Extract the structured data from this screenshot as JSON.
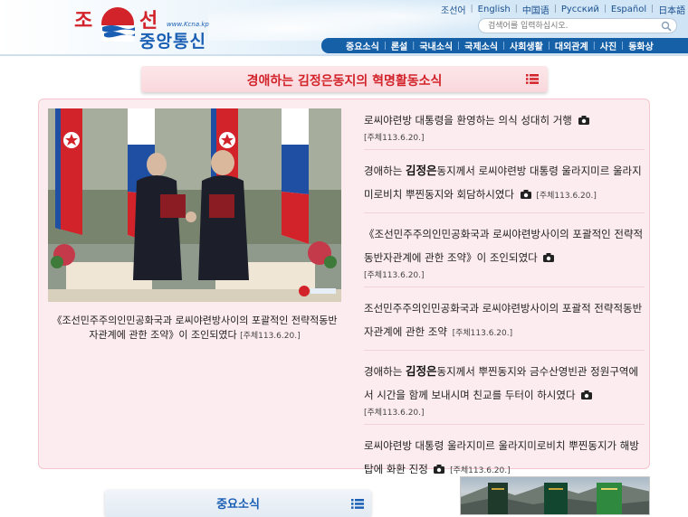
{
  "header": {
    "logo": {
      "word1": "조",
      "word2": "선",
      "word3": "중앙통신",
      "url_text": "www.Kcna.kp"
    },
    "languages": [
      "조선어",
      "English",
      "中国语",
      "Pусский",
      "Español",
      "日本語"
    ],
    "search": {
      "placeholder": "검색어를 입력하십시오."
    },
    "nav": [
      "중요소식",
      "론설",
      "국내소식",
      "국제소식",
      "사회생활",
      "대외관계",
      "사진",
      "동화상"
    ]
  },
  "featured": {
    "section_title": "경애하는 김정은동지의 혁명활동소식",
    "photo_caption": "《조선민주주의인민공화국과 로씨야련방사이의 포괄적인 전략적동반자관계에 관한 조약》이 조인되였다",
    "photo_date": "[주체113.6.20.]",
    "items": [
      {
        "pre": "로씨야련방 대통령을 환영하는 의식 성대히 거행",
        "bold": "",
        "post": "",
        "camera": true,
        "date": "[주체113.6.20.]"
      },
      {
        "pre": "경애하는 ",
        "bold": "김정은",
        "post": "동지께서 로씨야련방 대통령 울라지미르 울라지미로비치 뿌찐동지와 회담하시였다",
        "camera": true,
        "date": "[주체113.6.20.]"
      },
      {
        "pre": "《조선민주주의인민공화국과 로씨야련방사이의 포괄적인 전략적동반자관계에 관한 조약》이 조인되였다",
        "bold": "",
        "post": "",
        "camera": true,
        "date": "[주체113.6.20.]"
      },
      {
        "pre": "조선민주주의인민공화국과 로씨야련방사이의 포괄적 전략적동반자관계에 관한 조약",
        "bold": "",
        "post": "",
        "camera": false,
        "date": "[주체113.6.20.]"
      },
      {
        "pre": "경애하는 ",
        "bold": "김정은",
        "post": "동지께서 뿌찐동지와 금수산영빈관 정원구역에서 시간을 함께 보내시며 친교를 두터이 하시였다",
        "camera": true,
        "date": "[주체113.6.20.]"
      },
      {
        "pre": "로씨야련방 대통령 울라지미르 울라지미로비치 뿌찐동지가 해방탑에 화환 진정",
        "bold": "",
        "post": "",
        "camera": true,
        "date": "[주체113.6.20.]"
      }
    ]
  },
  "important": {
    "section_title": "중요소식"
  },
  "colors": {
    "accent_red": "#d2232a",
    "nav_blue": "#1660a8",
    "panel_pink": "#fdecef"
  }
}
